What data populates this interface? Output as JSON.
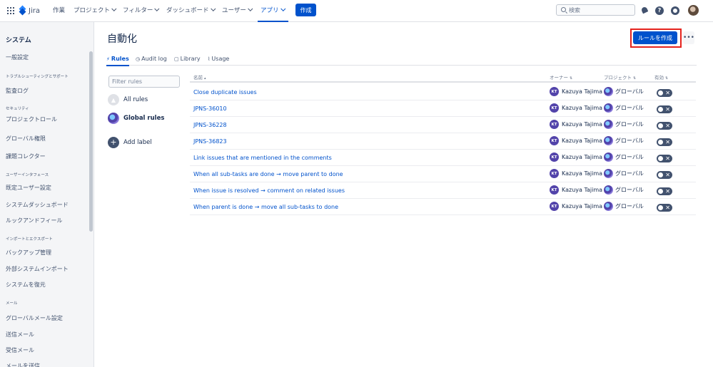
{
  "topnav": {
    "logo_text": "Jira",
    "items": [
      {
        "label": "作業",
        "has_chevron": false
      },
      {
        "label": "プロジェクト",
        "has_chevron": true
      },
      {
        "label": "フィルター",
        "has_chevron": true
      },
      {
        "label": "ダッシュボード",
        "has_chevron": true
      },
      {
        "label": "ユーザー",
        "has_chevron": true
      },
      {
        "label": "アプリ",
        "has_chevron": true,
        "active": true
      }
    ],
    "create_label": "作成",
    "search_placeholder": "検索",
    "help_glyph": "?",
    "icons": [
      "apps-grid-icon",
      "jira-logo-icon",
      "notifications-icon",
      "help-icon",
      "settings-icon",
      "user-avatar"
    ]
  },
  "sidebar": {
    "title": "システム",
    "entries": [
      {
        "type": "item",
        "label": "一般設定"
      },
      {
        "type": "section",
        "label": "トラブルシューティングとサポート"
      },
      {
        "type": "item",
        "label": "監査ログ"
      },
      {
        "type": "section",
        "label": "セキュリティ"
      },
      {
        "type": "item",
        "label": "プロジェクトロール"
      },
      {
        "type": "item",
        "label": "グローバル権限"
      },
      {
        "type": "item",
        "label": "課題コレクター"
      },
      {
        "type": "section",
        "label": "ユーザーインタフェース"
      },
      {
        "type": "item",
        "label": "既定ユーザー設定"
      },
      {
        "type": "item",
        "label": "システムダッシュボード"
      },
      {
        "type": "item",
        "label": "ルックアンドフィール"
      },
      {
        "type": "section",
        "label": "インポートとエクスポート"
      },
      {
        "type": "item",
        "label": "バックアップ管理"
      },
      {
        "type": "item",
        "label": "外部システムインポート"
      },
      {
        "type": "item",
        "label": "システムを復元"
      },
      {
        "type": "section",
        "label": "メール"
      },
      {
        "type": "item",
        "label": "グローバルメール設定"
      },
      {
        "type": "item",
        "label": "送信メール"
      },
      {
        "type": "item",
        "label": "受信メール"
      },
      {
        "type": "item",
        "label": "メールを送信"
      }
    ]
  },
  "main": {
    "title": "自動化",
    "create_rule_label": "ルールを作成",
    "more_label": "•••",
    "tabs": [
      {
        "label": "Rules",
        "icon": "⚡",
        "active": true
      },
      {
        "label": "Audit log",
        "icon": "◷"
      },
      {
        "label": "Library",
        "icon": "▢"
      },
      {
        "label": "Usage",
        "icon": "⌇"
      }
    ],
    "filter_placeholder": "Filter rules",
    "labels": [
      {
        "label": "All rules",
        "icon": "all"
      },
      {
        "label": "Global rules",
        "icon": "global"
      },
      {
        "label": "Add label",
        "icon": "add"
      }
    ]
  },
  "table": {
    "headers": {
      "name": "名前",
      "owner": "オーナー",
      "project": "プロジェクト",
      "enabled": "有効"
    },
    "rows": [
      {
        "name": "Close duplicate issues",
        "owner_initials": "KT",
        "owner": "Kazuya Tajima",
        "project": "グローバル",
        "enabled": false
      },
      {
        "name": "JPNS-36010",
        "owner_initials": "KT",
        "owner": "Kazuya Tajima",
        "project": "グローバル",
        "enabled": false
      },
      {
        "name": "JPNS-36228",
        "owner_initials": "KT",
        "owner": "Kazuya Tajima",
        "project": "グローバル",
        "enabled": false
      },
      {
        "name": "JPNS-36823",
        "owner_initials": "KT",
        "owner": "Kazuya Tajima",
        "project": "グローバル",
        "enabled": false
      },
      {
        "name": "Link issues that are mentioned in the comments",
        "owner_initials": "KT",
        "owner": "Kazuya Tajima",
        "project": "グローバル",
        "enabled": false
      },
      {
        "name": "When all sub-tasks are done → move parent to done",
        "owner_initials": "KT",
        "owner": "Kazuya Tajima",
        "project": "グローバル",
        "enabled": false
      },
      {
        "name": "When issue is resolved → comment on related issues",
        "owner_initials": "KT",
        "owner": "Kazuya Tajima",
        "project": "グローバル",
        "enabled": false
      },
      {
        "name": "When parent is done → move all sub-tasks to done",
        "owner_initials": "KT",
        "owner": "Kazuya Tajima",
        "project": "グローバル",
        "enabled": false
      }
    ]
  },
  "colors": {
    "accent": "#0052cc",
    "highlight": "#e5231d",
    "toggle_off": "#42526e"
  }
}
